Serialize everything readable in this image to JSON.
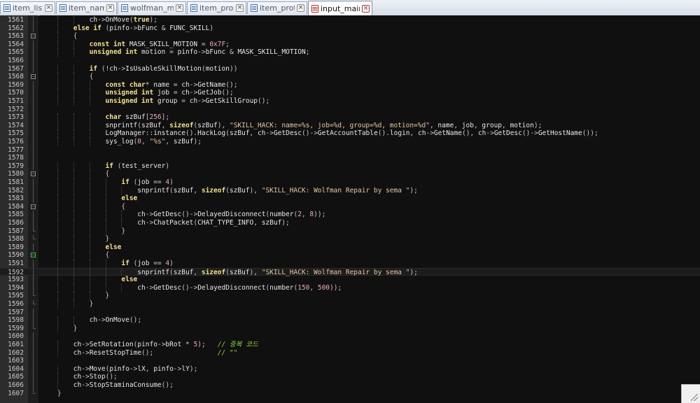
{
  "tabs": [
    {
      "label": "item_list.txt",
      "active": false
    },
    {
      "label": "item_names.txt",
      "active": false
    },
    {
      "label": "wolfman_m.msm",
      "active": false
    },
    {
      "label": "item_proto.txt",
      "active": false
    },
    {
      "label": "item_proto.txt",
      "active": false
    },
    {
      "label": "input_main.cpp",
      "active": true
    }
  ],
  "tab_close_glyph": "×",
  "colors": {
    "background": "#101010",
    "keyword": "#f2e38a",
    "string": "#e6c7a0",
    "number": "#e9a8c2",
    "comment": "#8fd33a",
    "fold_marker_active": "#3fbf3f"
  },
  "editor": {
    "current_line": 1592,
    "lines": [
      {
        "n": "1561",
        "f": "v",
        "code": "            ch->OnMove(true);"
      },
      {
        "n": "1562",
        "f": "v",
        "code": "        else if (pinfo->bFunc & FUNC_SKILL)"
      },
      {
        "n": "1563",
        "f": "-",
        "code": "        {"
      },
      {
        "n": "1564",
        "f": "v",
        "code": "            const int MASK_SKILL_MOTION = 0x7F;"
      },
      {
        "n": "1565",
        "f": "v",
        "code": "            unsigned int motion = pinfo->bFunc & MASK_SKILL_MOTION;"
      },
      {
        "n": "1566",
        "f": "v",
        "code": ""
      },
      {
        "n": "1567",
        "f": "v",
        "code": "            if (!ch->IsUsableSkillMotion(motion))"
      },
      {
        "n": "1568",
        "f": "-",
        "code": "            {"
      },
      {
        "n": "1569",
        "f": "v",
        "code": "                const char* name = ch->GetName();"
      },
      {
        "n": "1570",
        "f": "v",
        "code": "                unsigned int job = ch->GetJob();"
      },
      {
        "n": "1571",
        "f": "v",
        "code": "                unsigned int group = ch->GetSkillGroup();"
      },
      {
        "n": "1572",
        "f": "v",
        "code": ""
      },
      {
        "n": "1573",
        "f": "v",
        "code": "                char szBuf[256];"
      },
      {
        "n": "1574",
        "f": "v",
        "code": "                snprintf(szBuf, sizeof(szBuf), \"SKILL_HACK: name=%s, job=%d, group=%d, motion=%d\", name, job, group, motion);"
      },
      {
        "n": "1575",
        "f": "v",
        "code": "                LogManager::instance().HackLog(szBuf, ch->GetDesc()->GetAccountTable().login, ch->GetName(), ch->GetDesc()->GetHostName());"
      },
      {
        "n": "1576",
        "f": "v",
        "code": "                sys_log(0, \"%s\", szBuf);"
      },
      {
        "n": "1577",
        "f": "v",
        "code": ""
      },
      {
        "n": "1578",
        "f": "v",
        "code": ""
      },
      {
        "n": "1579",
        "f": "v",
        "code": "                if (test_server)"
      },
      {
        "n": "1580",
        "f": "-",
        "code": "                {"
      },
      {
        "n": "1581",
        "f": "v",
        "code": "                    if (job == 4)"
      },
      {
        "n": "1582",
        "f": "v",
        "code": "                        snprintf(szBuf, sizeof(szBuf), \"SKILL_HACK: Wolfman Repair by sema \");"
      },
      {
        "n": "1583",
        "f": "v",
        "code": "                    else"
      },
      {
        "n": "1584",
        "f": "-",
        "code": "                    {"
      },
      {
        "n": "1585",
        "f": "v",
        "code": "                        ch->GetDesc()->DelayedDisconnect(number(2, 8));"
      },
      {
        "n": "1586",
        "f": "v",
        "code": "                        ch->ChatPacket(CHAT_TYPE_INFO, szBuf);"
      },
      {
        "n": "1587",
        "f": "L",
        "code": "                    }"
      },
      {
        "n": "1588",
        "f": "L",
        "code": "                }"
      },
      {
        "n": "1589",
        "f": "v",
        "code": "                else"
      },
      {
        "n": "1590",
        "f": "G",
        "code": "                {"
      },
      {
        "n": "1591",
        "f": "v",
        "code": "                    if (job == 4)"
      },
      {
        "n": "1592",
        "f": "v",
        "code": "                        snprintf(szBuf, sizeof(szBuf), \"SKILL_HACK: Wolfman Repair by sema \");"
      },
      {
        "n": "1593",
        "f": "v",
        "code": "                    else"
      },
      {
        "n": "1594",
        "f": "v",
        "code": "                        ch->GetDesc()->DelayedDisconnect(number(150, 500));"
      },
      {
        "n": "1595",
        "f": "L",
        "code": "                }"
      },
      {
        "n": "1596",
        "f": "L",
        "code": "            }"
      },
      {
        "n": "1597",
        "f": "v",
        "code": ""
      },
      {
        "n": "1598",
        "f": "v",
        "code": "            ch->OnMove();"
      },
      {
        "n": "1599",
        "f": "L",
        "code": "        }"
      },
      {
        "n": "1600",
        "f": "v",
        "code": ""
      },
      {
        "n": "1601",
        "f": "v",
        "code": "        ch->SetRotation(pinfo->bRot * 5);   // 중복 코드"
      },
      {
        "n": "1602",
        "f": "v",
        "code": "        ch->ResetStopTime();                // \"\""
      },
      {
        "n": "1603",
        "f": "v",
        "code": ""
      },
      {
        "n": "1604",
        "f": "v",
        "code": "        ch->Move(pinfo->lX, pinfo->lY);"
      },
      {
        "n": "1605",
        "f": "v",
        "code": "        ch->Stop();"
      },
      {
        "n": "1606",
        "f": "v",
        "code": "        ch->StopStaminaConsume();"
      },
      {
        "n": "1607",
        "f": "L",
        "code": "    }"
      }
    ]
  }
}
